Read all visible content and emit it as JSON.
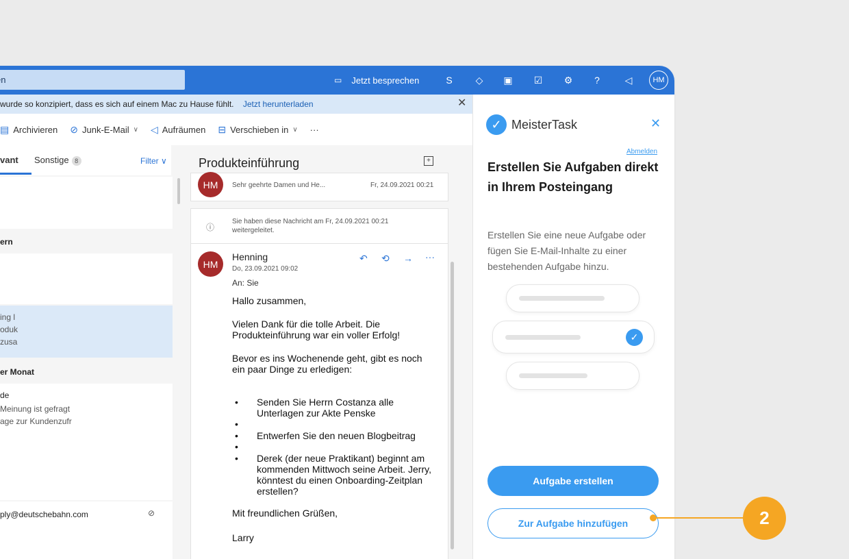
{
  "topbar": {
    "search_text": "en",
    "meet_label": "Jetzt besprechen",
    "avatar_initials": "HM"
  },
  "banner": {
    "text": "wurde so konzipiert, dass es sich auf einem Mac zu Hause fühlt.",
    "link": "Jetzt herunterladen"
  },
  "toolbar": {
    "items": [
      "Archivieren",
      "Junk-E-Mail",
      "Aufräumen",
      "Verschieben in",
      "···"
    ]
  },
  "list": {
    "tab_focused": "vant",
    "tab_other": "Sonstige",
    "other_count": "8",
    "filter": "Filter",
    "group1": "ern",
    "item_sel": [
      "ing l",
      "oduk",
      "zusa"
    ],
    "group2": "er Monat",
    "item2": [
      "de",
      "Meinung ist gefragt",
      "age zur Kundenzufr"
    ],
    "item3_sender": "ply@deutschebahn.com"
  },
  "message": {
    "subject": "Produkteinführung",
    "prev_sender_initials": "HM",
    "prev_preview": "Sehr geehrte Damen und He...",
    "prev_date": "Fr, 24.09.2021 00:21",
    "forward_note": "Sie haben diese Nachricht am Fr, 24.09.2021 00:21 weitergeleitet.",
    "sender": "Henning",
    "sender_initials": "HM",
    "date": "Do, 23.09.2021 09:02",
    "to": "An: Sie",
    "greeting": "Hallo zusammen,",
    "p1": "Vielen Dank für die tolle Arbeit. Die Produkteinführung war ein voller Erfolg!",
    "p2": "Bevor es ins Wochenende geht, gibt es noch ein paar Dinge zu erledigen:",
    "bullets": [
      "Senden Sie Herrn Costanza alle Unterlagen zur Akte Penske",
      "Entwerfen Sie den neuen Blogbeitrag",
      "Derek (der neue Praktikant) beginnt am kommenden Mittwoch seine Arbeit. Jerry, könntest du einen Onboarding-Zeitplan erstellen?"
    ],
    "closing": "Mit freundlichen Grüßen,",
    "signature": "Larry"
  },
  "panel": {
    "brand": "MeisterTask",
    "logout": "Abmelden",
    "heading": "Erstellen Sie Aufgaben direkt in Ihrem Posteingang",
    "description": "Erstellen Sie eine neue Aufgabe oder fügen Sie E-Mail-Inhalte zu einer bestehenden Aufgabe hinzu.",
    "btn_create": "Aufgabe erstellen",
    "btn_add": "Zur Aufgabe hinzufügen"
  },
  "callout": {
    "number": "2"
  },
  "colors": {
    "accent": "#2b74d6",
    "meistertask": "#3a9bf0",
    "callout": "#f5a623",
    "avatar": "#a62b2b"
  }
}
